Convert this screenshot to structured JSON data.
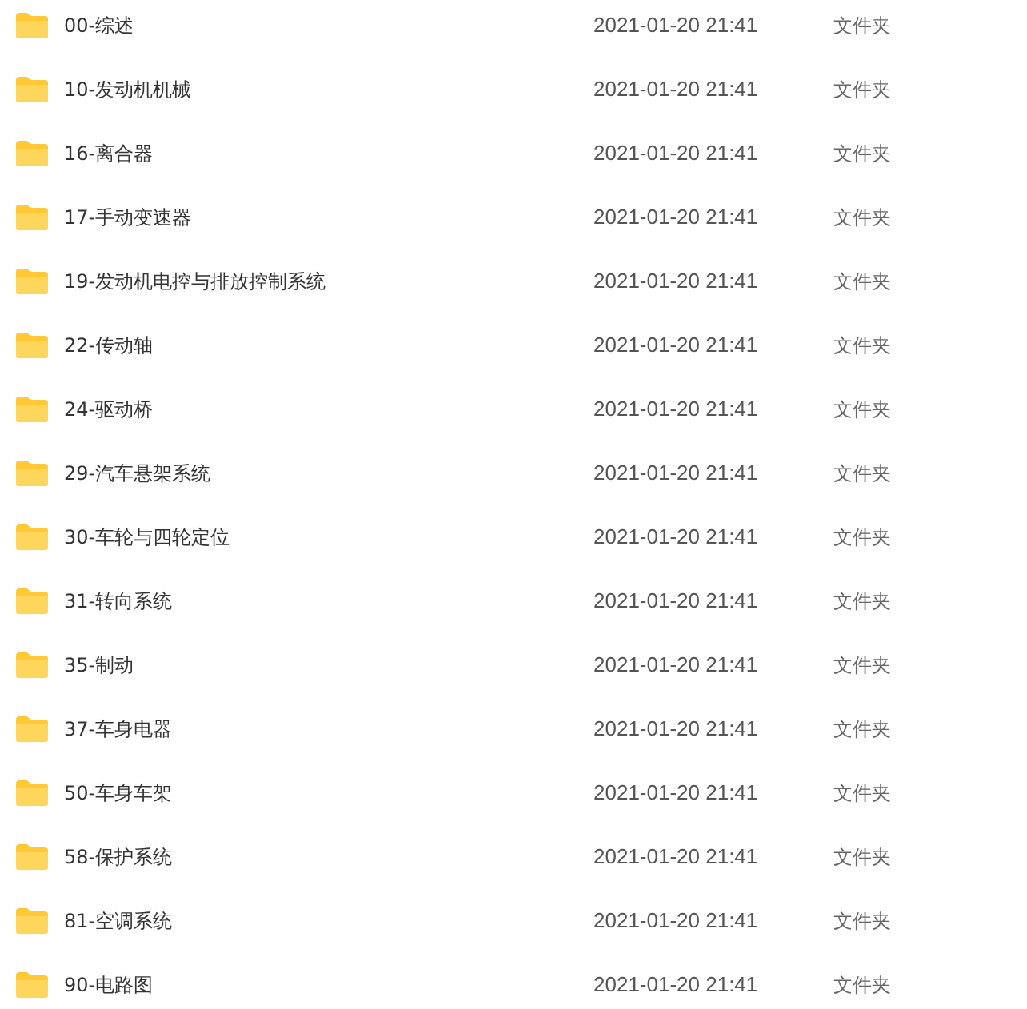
{
  "files": [
    {
      "name": "00-综述",
      "modified": "2021-01-20 21:41",
      "type": "文件夹"
    },
    {
      "name": "10-发动机机械",
      "modified": "2021-01-20 21:41",
      "type": "文件夹"
    },
    {
      "name": "16-离合器",
      "modified": "2021-01-20 21:41",
      "type": "文件夹"
    },
    {
      "name": "17-手动变速器",
      "modified": "2021-01-20 21:41",
      "type": "文件夹"
    },
    {
      "name": "19-发动机电控与排放控制系统",
      "modified": "2021-01-20 21:41",
      "type": "文件夹"
    },
    {
      "name": "22-传动轴",
      "modified": "2021-01-20 21:41",
      "type": "文件夹"
    },
    {
      "name": "24-驱动桥",
      "modified": "2021-01-20 21:41",
      "type": "文件夹"
    },
    {
      "name": "29-汽车悬架系统",
      "modified": "2021-01-20 21:41",
      "type": "文件夹"
    },
    {
      "name": "30-车轮与四轮定位",
      "modified": "2021-01-20 21:41",
      "type": "文件夹"
    },
    {
      "name": "31-转向系统",
      "modified": "2021-01-20 21:41",
      "type": "文件夹"
    },
    {
      "name": "35-制动",
      "modified": "2021-01-20 21:41",
      "type": "文件夹"
    },
    {
      "name": "37-车身电器",
      "modified": "2021-01-20 21:41",
      "type": "文件夹"
    },
    {
      "name": "50-车身车架",
      "modified": "2021-01-20 21:41",
      "type": "文件夹"
    },
    {
      "name": "58-保护系统",
      "modified": "2021-01-20 21:41",
      "type": "文件夹"
    },
    {
      "name": "81-空调系统",
      "modified": "2021-01-20 21:41",
      "type": "文件夹"
    },
    {
      "name": "90-电路图",
      "modified": "2021-01-20 21:41",
      "type": "文件夹"
    }
  ]
}
